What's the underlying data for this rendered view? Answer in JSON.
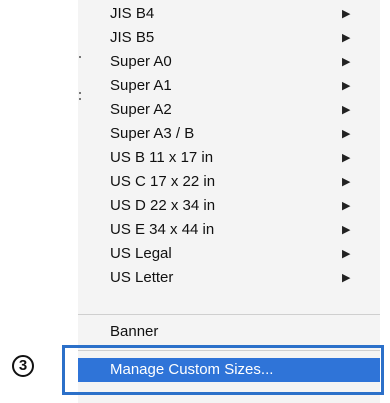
{
  "menu": {
    "items": [
      {
        "label": "JIS B4",
        "has_submenu": true
      },
      {
        "label": "JIS B5",
        "has_submenu": true
      },
      {
        "label": "Super A0",
        "has_submenu": true
      },
      {
        "label": "Super A1",
        "has_submenu": true
      },
      {
        "label": "Super A2",
        "has_submenu": true
      },
      {
        "label": "Super A3 / B",
        "has_submenu": true
      },
      {
        "label": "US B 11 x 17 in",
        "has_submenu": true
      },
      {
        "label": "US C 17 x 22 in",
        "has_submenu": true
      },
      {
        "label": "US D 22 x 34 in",
        "has_submenu": true
      },
      {
        "label": "US E 34 x 44 in",
        "has_submenu": true
      },
      {
        "label": "US Legal",
        "has_submenu": true
      },
      {
        "label": "US Letter",
        "has_submenu": true
      }
    ],
    "submenu_arrow": "▶",
    "banner_label": "Banner",
    "manage_label": "Manage Custom Sizes..."
  },
  "annotation": {
    "step_number": "③",
    "box_color": "#2b70c9"
  },
  "colors": {
    "menu_background": "#f4f4f4",
    "highlight": "#2f74d8",
    "highlight_text": "#ffffff"
  }
}
